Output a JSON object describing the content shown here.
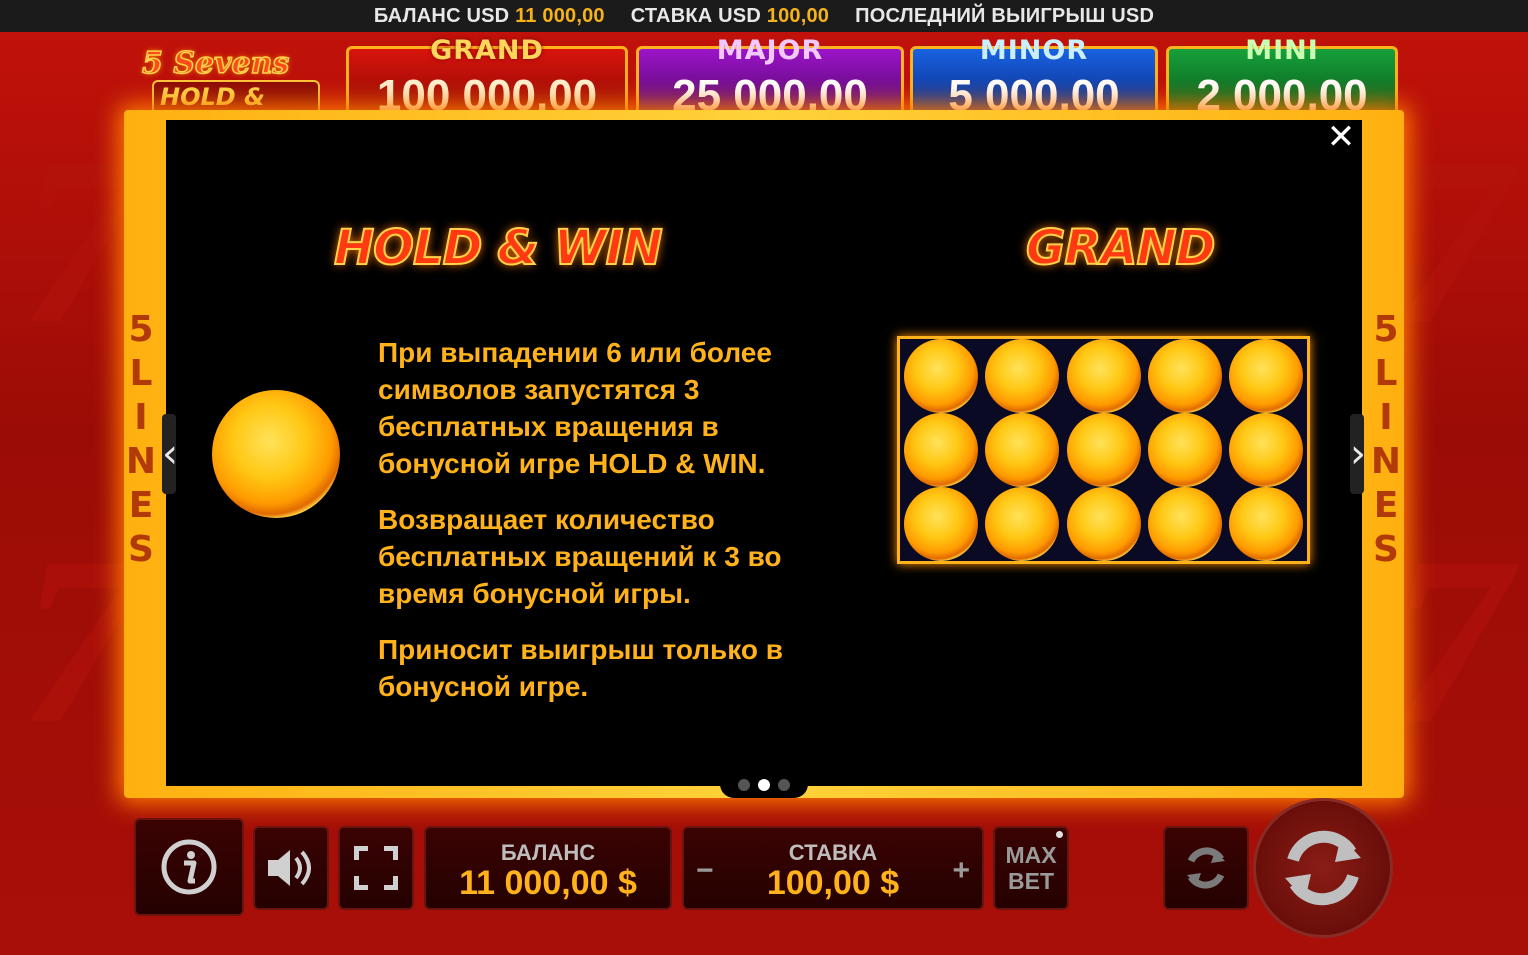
{
  "top_bar": {
    "balance_label": "БАЛАНС USD",
    "balance_value": "11 000,00",
    "bet_label": "СТАВКА USD",
    "bet_value": "100,00",
    "last_win_label": "ПОСЛЕДНИЙ ВЫИГРЫШ USD"
  },
  "logo": {
    "line1": "5 Sevens",
    "line2": "HOLD & WIN"
  },
  "jackpots": [
    {
      "label": "GRAND",
      "amount": "100 000,00"
    },
    {
      "label": "MAJOR",
      "amount": "25 000,00"
    },
    {
      "label": "MINOR",
      "amount": "5 000,00"
    },
    {
      "label": "MINI",
      "amount": "2 000,00"
    }
  ],
  "side_label": "5 LINES",
  "side_label_chars": [
    "5",
    "L",
    "I",
    "N",
    "E",
    "S"
  ],
  "paytable": {
    "left_title": "HOLD & WIN",
    "right_title": "GRAND",
    "paragraphs": [
      "При выпадении 6 или более символов запустятся 3 бесплатных вращения в бонусной игре HOLD & WIN.",
      "Возвращает количество бесплатных вращений к 3 во время бонусной игры.",
      "Приносит выигрыш только в бонусной игре."
    ],
    "grid_rows": 3,
    "grid_cols": 5,
    "page_current": 2,
    "page_total": 3
  },
  "bottom": {
    "balance_title": "БАЛАНС",
    "balance_value": "11 000,00 $",
    "bet_title": "СТАВКА",
    "bet_value": "100,00 $",
    "minus": "−",
    "plus": "+",
    "max_bet_line1": "MAX",
    "max_bet_line2": "BET"
  },
  "icons": [
    "info-icon",
    "sound-icon",
    "fullscreen-icon",
    "autoplay-icon",
    "spin-icon",
    "close-icon",
    "chevron-left-icon",
    "chevron-right-icon"
  ],
  "colors": {
    "accent": "#ffb21a",
    "background": "#a80f08",
    "panel": "#000000"
  }
}
